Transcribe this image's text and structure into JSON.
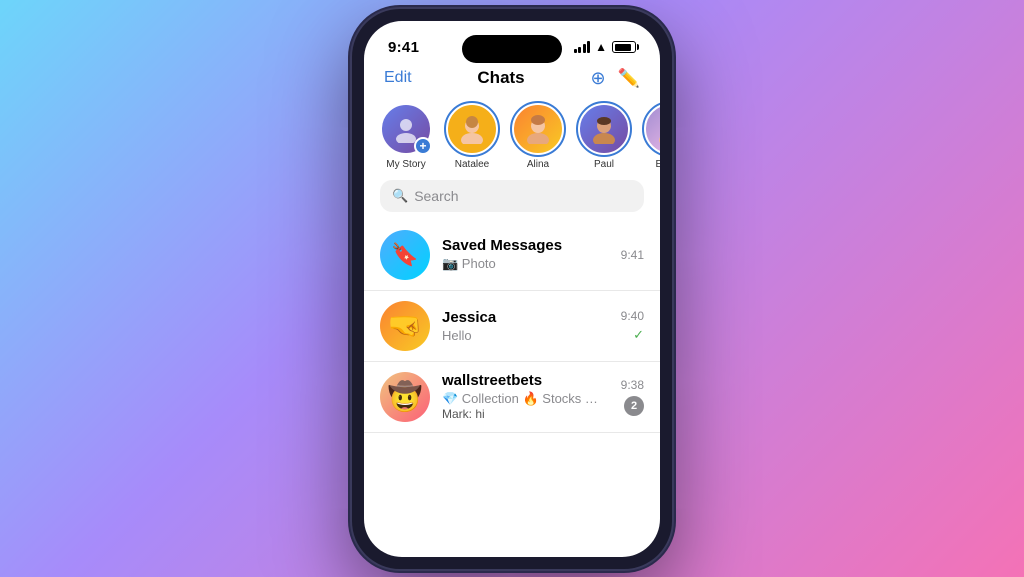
{
  "background": {
    "gradient": "linear-gradient(135deg, #6dd5fa 0%, #a78bfa 40%, #f472b6 100%)"
  },
  "statusBar": {
    "time": "9:41",
    "icons": [
      "signal",
      "wifi",
      "battery"
    ]
  },
  "navBar": {
    "editLabel": "Edit",
    "title": "Chats",
    "addIcon": "⊕",
    "composeIcon": "✎"
  },
  "stories": [
    {
      "id": "my-story",
      "name": "My Story",
      "hasRing": false,
      "hasPlus": true,
      "avatarClass": "my-story-avatar",
      "emoji": "👤"
    },
    {
      "id": "natalee",
      "name": "Natalee",
      "hasRing": true,
      "hasPlus": false,
      "avatarClass": "av-natalee",
      "emoji": "👱‍♀️"
    },
    {
      "id": "alina",
      "name": "Alina",
      "hasRing": true,
      "hasPlus": false,
      "avatarClass": "av-alina",
      "emoji": "👩"
    },
    {
      "id": "paul",
      "name": "Paul",
      "hasRing": true,
      "hasPlus": false,
      "avatarClass": "av-paul",
      "emoji": "👨"
    },
    {
      "id": "emma",
      "name": "Emma",
      "hasRing": true,
      "hasPlus": false,
      "avatarClass": "av-emma",
      "emoji": "👩‍🦰"
    }
  ],
  "searchBar": {
    "placeholder": "Search",
    "icon": "🔍"
  },
  "chats": [
    {
      "id": "saved-messages",
      "name": "Saved Messages",
      "preview": "📷 Photo",
      "time": "9:41",
      "badge": null,
      "checkmark": null,
      "avatarType": "saved",
      "avatarEmoji": "🔖"
    },
    {
      "id": "jessica",
      "name": "Jessica",
      "preview": "Hello",
      "time": "9:40",
      "badge": null,
      "checkmark": "✓",
      "avatarType": "jessica",
      "avatarEmoji": "🤼"
    },
    {
      "id": "wallstreetbets",
      "name": "wallstreetbets",
      "preview": "💎 Collection 🔥 Stocks 🐻 Memes...",
      "previewSub": "Mark: hi",
      "time": "9:38",
      "badge": "2",
      "checkmark": null,
      "avatarType": "wsb",
      "avatarEmoji": "🤠"
    }
  ]
}
